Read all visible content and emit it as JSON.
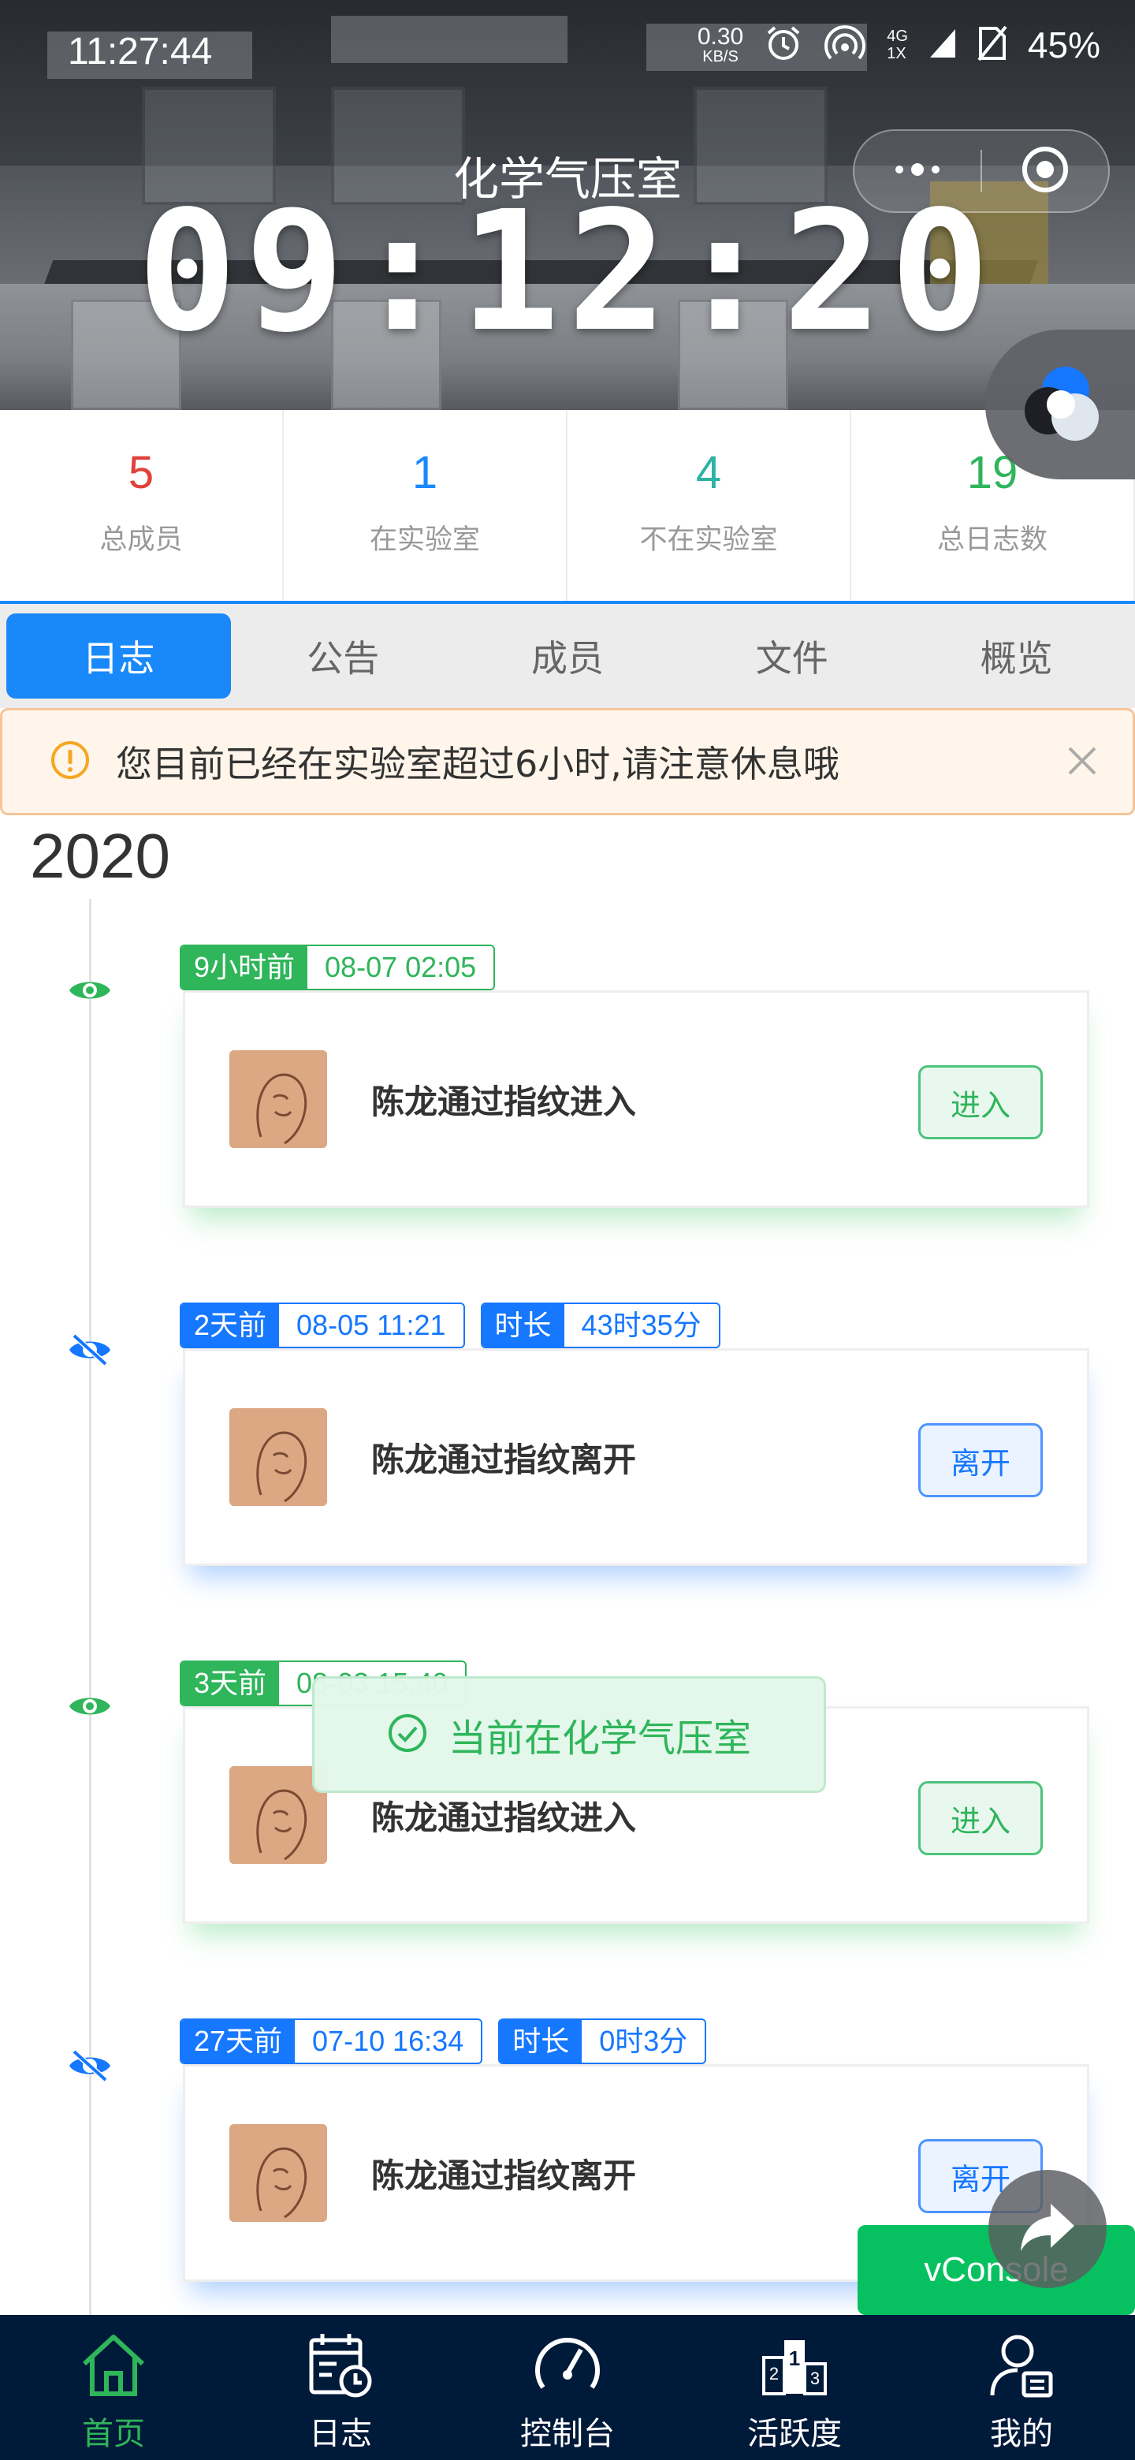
{
  "status_bar": {
    "time": "11:27:44",
    "net_speed": "0.30",
    "net_speed_unit": "KB/S",
    "net_type_top": "4G",
    "net_type_bottom": "1X",
    "battery": "45%"
  },
  "header": {
    "title": "化学气压室",
    "timer": "09:12:20"
  },
  "stats": [
    {
      "value": "5",
      "label": "总成员",
      "color": "#e0413a"
    },
    {
      "value": "1",
      "label": "在实验室",
      "color": "#1989fa"
    },
    {
      "value": "4",
      "label": "不在实验室",
      "color": "#2bb3a3"
    },
    {
      "value": "19",
      "label": "总日志数",
      "color": "#2fb55a"
    }
  ],
  "tabs": [
    {
      "label": "日志",
      "active": true
    },
    {
      "label": "公告",
      "active": false
    },
    {
      "label": "成员",
      "active": false
    },
    {
      "label": "文件",
      "active": false
    },
    {
      "label": "概览",
      "active": false
    }
  ],
  "notice": {
    "text": "您目前已经在实验室超过6小时,请注意休息哦"
  },
  "timeline": {
    "year": "2020",
    "entries": [
      {
        "status": "enter",
        "ago": "9小时前",
        "datetime": "08-07 02:05",
        "text": "陈龙通过指纹进入",
        "action": "进入"
      },
      {
        "status": "leave",
        "ago": "2天前",
        "datetime": "08-05 11:21",
        "duration_label": "时长",
        "duration": "43时35分",
        "text": "陈龙通过指纹离开",
        "action": "离开"
      },
      {
        "status": "enter",
        "ago": "3天前",
        "datetime": "08-03 15:40",
        "text": "陈龙通过指纹进入",
        "action": "进入"
      },
      {
        "status": "leave",
        "ago": "27天前",
        "datetime": "07-10 16:34",
        "duration_label": "时长",
        "duration": "0时3分",
        "text": "陈龙通过指纹离开",
        "action": "离开"
      }
    ]
  },
  "toast": {
    "text": "当前在化学气压室"
  },
  "vconsole": {
    "label": "vConsole"
  },
  "bottom_nav": [
    {
      "label": "首页",
      "icon": "home-icon",
      "active": true
    },
    {
      "label": "日志",
      "icon": "calendar-clock-icon",
      "active": false
    },
    {
      "label": "控制台",
      "icon": "speedometer-icon",
      "active": false
    },
    {
      "label": "活跃度",
      "icon": "podium-icon",
      "active": false
    },
    {
      "label": "我的",
      "icon": "user-id-icon",
      "active": false
    }
  ],
  "colors": {
    "primary": "#1989fa",
    "success": "#2fb55a",
    "warning": "#f5a623",
    "nav_bg": "#001a3a"
  }
}
